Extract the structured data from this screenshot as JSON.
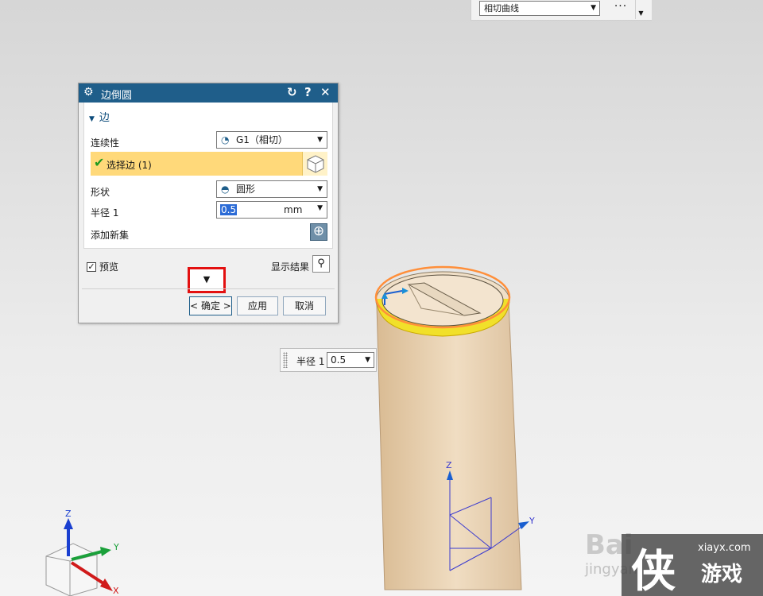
{
  "toolbar": {
    "curve_select": "相切曲线",
    "more_label": "···"
  },
  "dialog": {
    "title": "边倒圆",
    "section_label": "边",
    "continuity_label": "连续性",
    "continuity_value": "G1（相切）",
    "select_edge_label": "选择边 (1)",
    "shape_label": "形状",
    "shape_value": "圆形",
    "radius_label": "半径 1",
    "radius_value": "0.5",
    "radius_unit": "mm",
    "add_set_label": "添加新集",
    "preview_label": "预览",
    "show_result_label": "显示结果",
    "ok_label": "< 确定 >",
    "apply_label": "应用",
    "cancel_label": "取消"
  },
  "float_widget": {
    "label": "半径 1",
    "value": "0.5"
  },
  "axes": {
    "z": "Z",
    "y": "Y",
    "x": "X"
  },
  "watermark": {
    "brand": "Bai",
    "brand_sub": "jingyan",
    "site": "xiayx.com",
    "logo_char": "侠",
    "logo_name": "游戏"
  },
  "colors": {
    "title_bar": "#1f5e8a",
    "selection_row": "#ffd97a",
    "highlight_box": "#e31010",
    "cylinder": "#e8cfae",
    "edge_highlight": "#f1e02a"
  }
}
